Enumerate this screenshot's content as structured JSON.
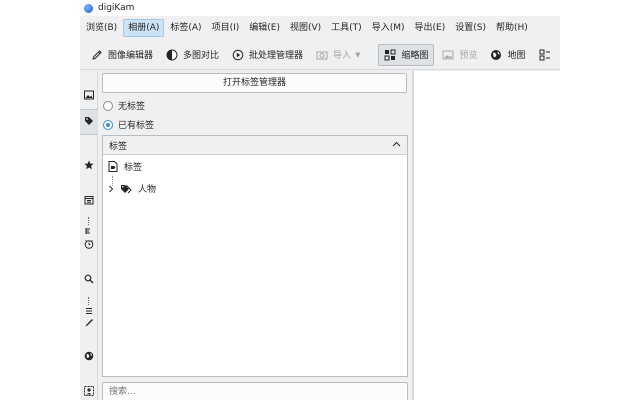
{
  "window": {
    "title": "digiKam"
  },
  "menu": [
    {
      "label": "浏览(B)",
      "active": false
    },
    {
      "label": "相册(A)",
      "active": true
    },
    {
      "label": "标签(A)",
      "active": false
    },
    {
      "label": "项目(I)",
      "active": false
    },
    {
      "label": "编辑(E)",
      "active": false
    },
    {
      "label": "视图(V)",
      "active": false
    },
    {
      "label": "工具(T)",
      "active": false
    },
    {
      "label": "导入(M)",
      "active": false
    },
    {
      "label": "导出(E)",
      "active": false
    },
    {
      "label": "设置(S)",
      "active": false
    },
    {
      "label": "帮助(H)",
      "active": false
    }
  ],
  "toolbar": {
    "image_editor": "图像编辑器",
    "light_table": "多图对比",
    "batch_queue": "批处理管理器",
    "import": "导入",
    "thumbnails": "缩略图",
    "preview": "预览",
    "map": "地图"
  },
  "panel": {
    "open_tag_manager": "打开标签管理器",
    "radio_no_tags": "无标签",
    "radio_has_tags": "已有标签",
    "selected_radio": "已有标签",
    "tree_header": "标签",
    "tree_items": [
      {
        "label": "标签",
        "icon": "new-tag-icon"
      },
      {
        "label": "人物",
        "icon": "people-tag-icon"
      }
    ],
    "search_placeholder": "搜索..."
  },
  "colors": {
    "accent": "#3d8fd6",
    "menu_highlight": "#cce3f5",
    "window_bg": "#eff0f1"
  }
}
